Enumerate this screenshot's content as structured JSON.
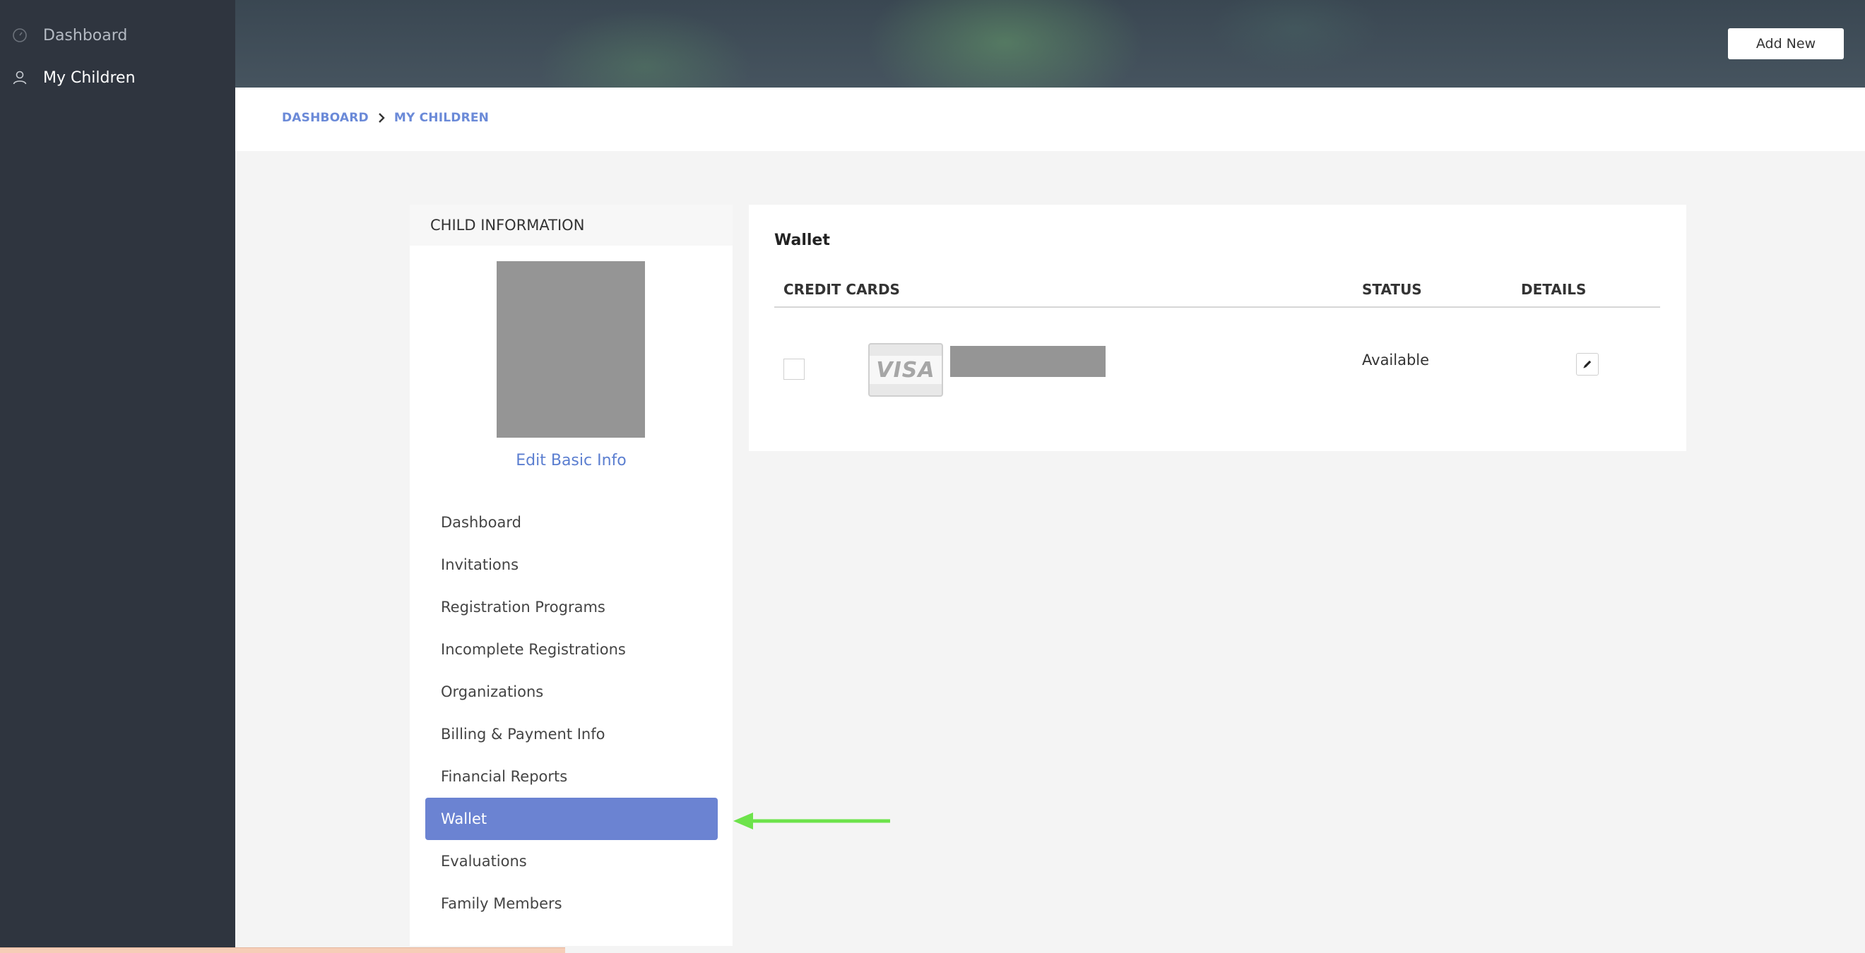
{
  "sidebar": {
    "items": [
      {
        "label": "Dashboard",
        "icon": "dashboard-icon"
      },
      {
        "label": "My Children",
        "icon": "user-icon"
      }
    ]
  },
  "header": {
    "add_new_label": "Add New"
  },
  "breadcrumb": {
    "items": [
      "DASHBOARD",
      "MY CHILDREN"
    ]
  },
  "child_panel": {
    "title": "CHILD INFORMATION",
    "edit_link": "Edit Basic Info",
    "menu": [
      "Dashboard",
      "Invitations",
      "Registration Programs",
      "Incomplete Registrations",
      "Organizations",
      "Billing & Payment Info",
      "Financial Reports",
      "Wallet",
      "Evaluations",
      "Family Members"
    ],
    "active_item": "Wallet"
  },
  "wallet": {
    "title": "Wallet",
    "columns": [
      "CREDIT CARDS",
      "STATUS",
      "DETAILS"
    ],
    "cards": [
      {
        "brand": "VISA",
        "status": "Available"
      }
    ]
  },
  "colors": {
    "accent": "#6b83d2",
    "link": "#5b7ed0",
    "sidebar_bg": "#2f353f",
    "arrow": "#6de34b"
  }
}
